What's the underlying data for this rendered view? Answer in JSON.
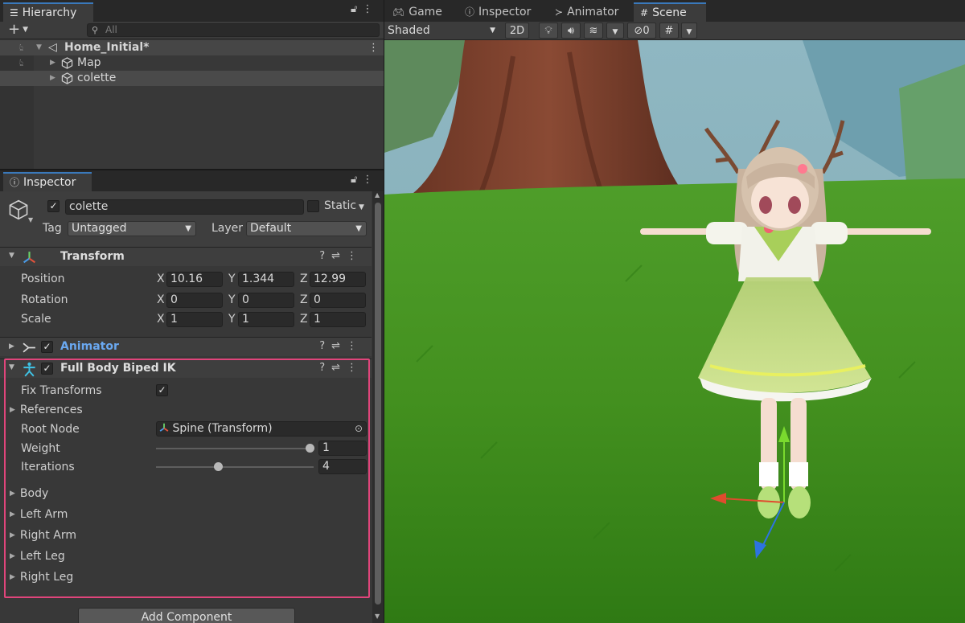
{
  "hierarchy": {
    "tab_label": "Hierarchy",
    "add_label": "+",
    "search_placeholder": "All",
    "scene_name": "Home_Initial*",
    "items": [
      {
        "label": "Map"
      },
      {
        "label": "colette"
      }
    ]
  },
  "inspector": {
    "tab_label": "Inspector",
    "object_name": "colette",
    "static_label": "Static",
    "tag_label": "Tag",
    "tag_value": "Untagged",
    "layer_label": "Layer",
    "layer_value": "Default",
    "transform": {
      "title": "Transform",
      "position_label": "Position",
      "rotation_label": "Rotation",
      "scale_label": "Scale",
      "axes": [
        "X",
        "Y",
        "Z"
      ],
      "position": [
        "10.16",
        "1.344",
        "12.99"
      ],
      "rotation": [
        "0",
        "0",
        "0"
      ],
      "scale": [
        "1",
        "1",
        "1"
      ]
    },
    "animator": {
      "title": "Animator"
    },
    "fbbik": {
      "title": "Full Body Biped IK",
      "fix_transforms_label": "Fix Transforms",
      "references_label": "References",
      "root_node_label": "Root Node",
      "root_node_value": "Spine (Transform)",
      "weight_label": "Weight",
      "weight_value": "1",
      "weight_fraction": 1.0,
      "iterations_label": "Iterations",
      "iterations_value": "4",
      "iterations_fraction": 0.4,
      "sections": [
        "Body",
        "Left Arm",
        "Right Arm",
        "Left Leg",
        "Right Leg"
      ]
    },
    "add_component_label": "Add Component"
  },
  "scene": {
    "tabs": [
      {
        "label": "Game",
        "icon": "gamepad-icon"
      },
      {
        "label": "Inspector",
        "icon": "info-icon"
      },
      {
        "label": "Animator",
        "icon": "animator-icon"
      },
      {
        "label": "Scene",
        "icon": "grid-icon"
      }
    ],
    "shading_mode": "Shaded",
    "mode_2d": "2D",
    "hidden_count": "0"
  },
  "colors": {
    "accent": "#3a79bb",
    "highlight_border": "#e0457b",
    "animator_title": "#6aa8f0"
  }
}
